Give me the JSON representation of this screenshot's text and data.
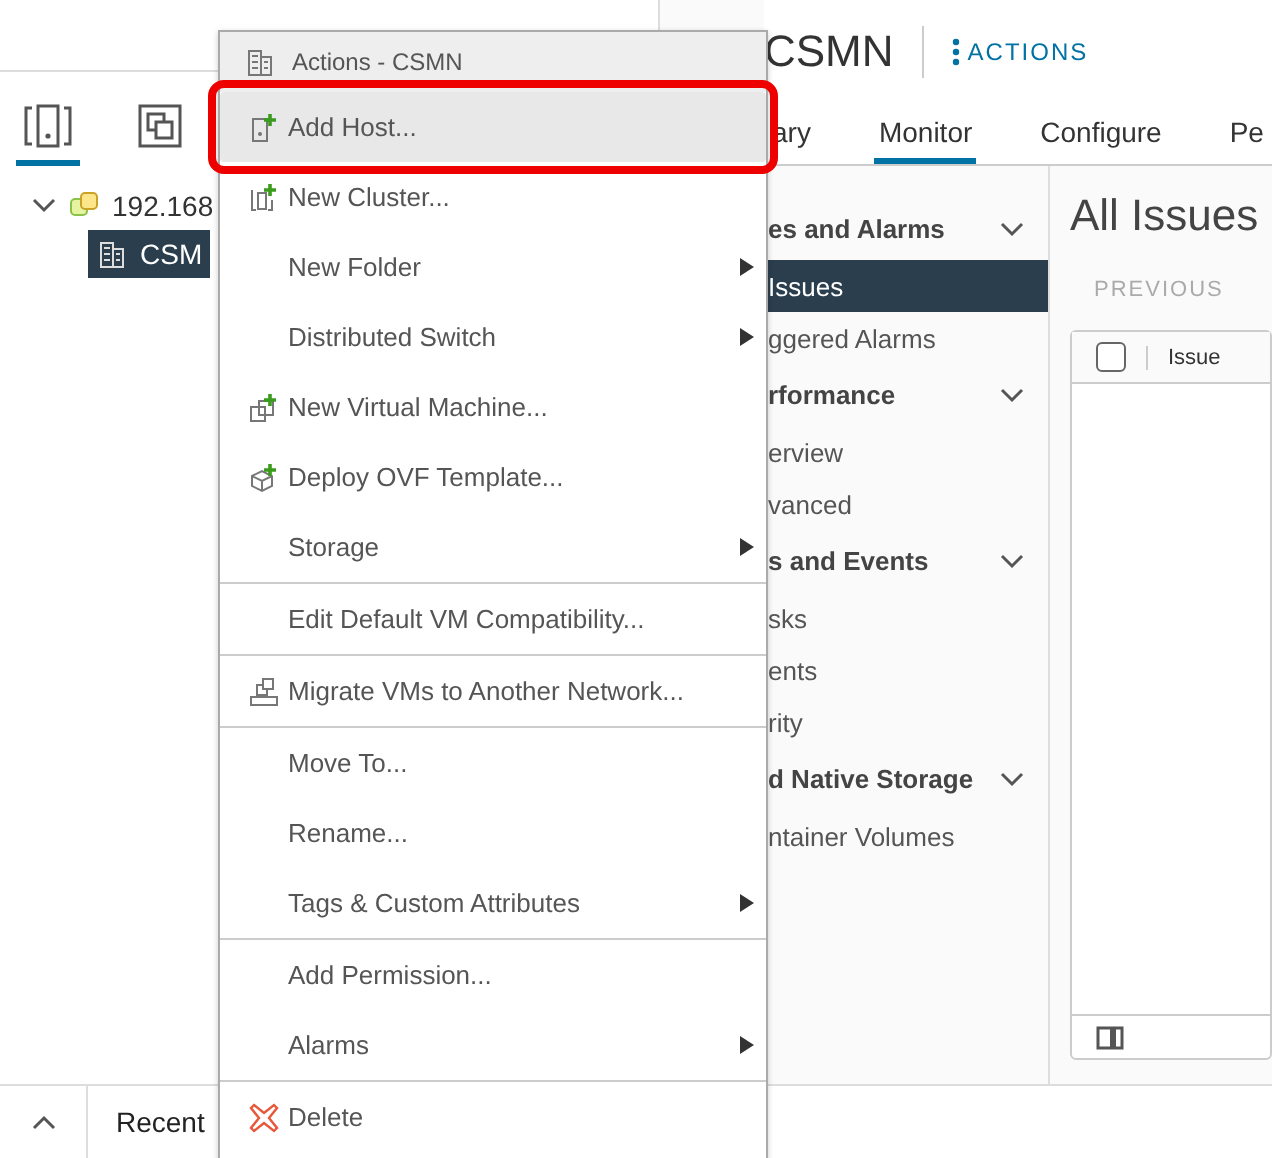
{
  "tree_tabs": [
    {
      "selected": true
    },
    {
      "selected": false
    }
  ],
  "tree": [
    {
      "label": "192.168",
      "expanded": true,
      "selected": false,
      "children": [
        {
          "label": "CSM",
          "selected": true
        }
      ]
    }
  ],
  "header": {
    "title": "CSMN",
    "actions": "ACTIONS"
  },
  "tabs": [
    {
      "label": "ary",
      "selected": false
    },
    {
      "label": "Monitor",
      "selected": true
    },
    {
      "label": "Configure",
      "selected": false
    },
    {
      "label": "Pe",
      "selected": false
    }
  ],
  "nav": [
    {
      "label": "es and Alarms",
      "expanded": true,
      "items": [
        {
          "label": "Issues",
          "selected": true
        },
        {
          "label": "ggered Alarms",
          "selected": false
        }
      ]
    },
    {
      "label": "rformance",
      "expanded": true,
      "items": [
        {
          "label": "erview",
          "selected": false
        },
        {
          "label": "vanced",
          "selected": false
        }
      ]
    },
    {
      "label": "s and Events",
      "expanded": true,
      "items": [
        {
          "label": "sks",
          "selected": false
        },
        {
          "label": "ents",
          "selected": false
        },
        {
          "label": "rity",
          "selected": false
        }
      ]
    },
    {
      "label": "d Native Storage",
      "expanded": true,
      "items": [
        {
          "label": "ntainer Volumes",
          "selected": false
        }
      ]
    }
  ],
  "main": {
    "title": "All Issues",
    "previous": "PREVIOUS",
    "columns": [
      "Issue"
    ],
    "select_all_checked": false
  },
  "bottom_bar": {
    "label": "Recent"
  },
  "menu": {
    "title": "Actions - CSMN",
    "groups": [
      [
        {
          "label": "Add Host...",
          "kind": "host",
          "selected": true,
          "submenu": false
        },
        {
          "label": "New Cluster...",
          "kind": "cluster",
          "selected": false,
          "submenu": false
        },
        {
          "label": "New Folder",
          "kind": "plain",
          "selected": false,
          "submenu": true
        },
        {
          "label": "Distributed Switch",
          "kind": "plain",
          "selected": false,
          "submenu": true
        },
        {
          "label": "New Virtual Machine...",
          "kind": "vm",
          "selected": false,
          "submenu": false
        },
        {
          "label": "Deploy OVF Template...",
          "kind": "ovf",
          "selected": false,
          "submenu": false
        },
        {
          "label": "Storage",
          "kind": "plain",
          "selected": false,
          "submenu": true
        }
      ],
      [
        {
          "label": "Edit Default VM Compatibility...",
          "kind": "plain",
          "selected": false,
          "submenu": false
        }
      ],
      [
        {
          "label": "Migrate VMs to Another Network...",
          "kind": "migrate",
          "selected": false,
          "submenu": false
        }
      ],
      [
        {
          "label": "Move To...",
          "kind": "plain",
          "selected": false,
          "submenu": false
        },
        {
          "label": "Rename...",
          "kind": "plain",
          "selected": false,
          "submenu": false
        },
        {
          "label": "Tags & Custom Attributes",
          "kind": "plain",
          "selected": false,
          "submenu": true
        }
      ],
      [
        {
          "label": "Add Permission...",
          "kind": "plain",
          "selected": false,
          "submenu": false
        },
        {
          "label": "Alarms",
          "kind": "plain",
          "selected": false,
          "submenu": true
        }
      ],
      [
        {
          "label": "Delete",
          "kind": "delete",
          "selected": false,
          "submenu": false
        }
      ]
    ]
  }
}
